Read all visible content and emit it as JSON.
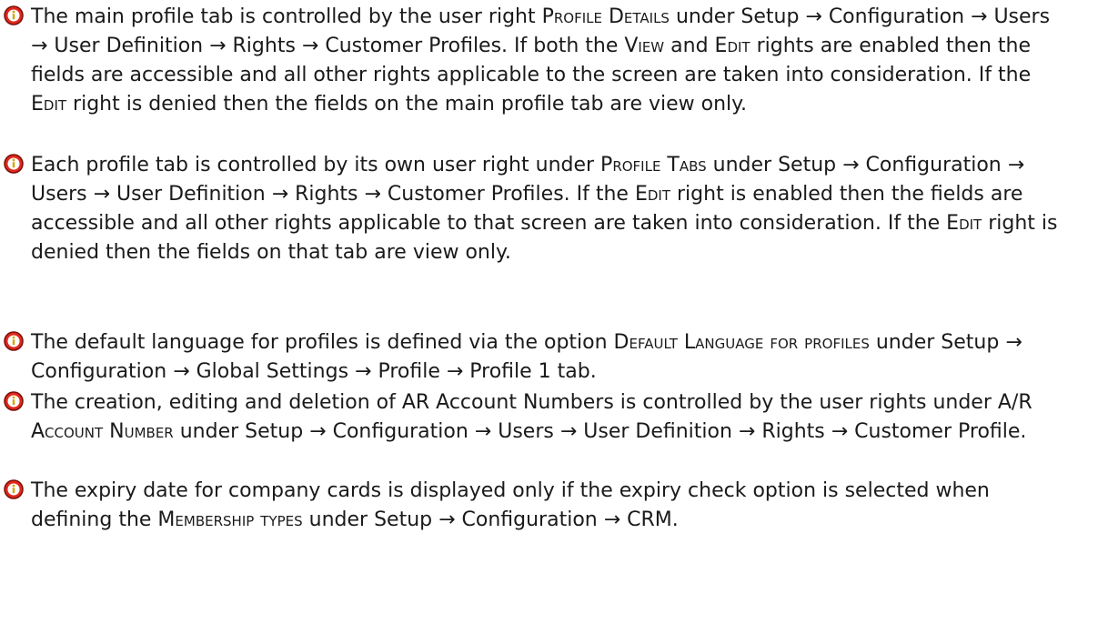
{
  "notes": [
    {
      "icon": "info-icon",
      "t1": "The main profile tab is controlled by the user right ",
      "s1": "Profile Details",
      "t2": " under Setup → Configuration → Users → User Definition → Rights → Customer Profiles. If both the ",
      "s2": "View",
      "t3": " and ",
      "s3": "Edit",
      "t4": " rights are enabled then the fields are accessible and all other rights applicable to the screen are taken into consideration. If the ",
      "s4": "Edit",
      "t5": " right is denied then the fields on the main profile tab are view only."
    },
    {
      "icon": "info-icon",
      "t1": "Each profile tab is controlled by its own user right under ",
      "s1": "Profile Tabs",
      "t2": " under Setup → Configuration → Users → User Definition → Rights → Customer Profiles. If the ",
      "s2": "Edit",
      "t3": " right is enabled then the fields are accessible and all other rights applicable to that screen are taken into consideration. If the ",
      "s3": "Edit",
      "t4": " right is denied then the fields on that tab are view only."
    },
    {
      "icon": "info-icon",
      "t1": "The default language for profiles is defined via the option ",
      "s1": "Default Language for profiles",
      "t2": " under Setup → Configuration → Global Settings → Profile → Profile 1 tab."
    },
    {
      "icon": "info-icon",
      "t1": "The creation, editing and deletion of AR Account Numbers is controlled by the user rights under ",
      "s1": "A/R Account Number",
      "t2": " under Setup → Configuration → Users → User Definition → Rights → Customer Profile."
    },
    {
      "icon": "info-icon",
      "t1": "The expiry date for company cards is displayed only if the expiry check option is selected when defining the ",
      "s1": "Membership types",
      "t2": " under Setup → Configuration → CRM."
    }
  ],
  "colors": {
    "icon_red": "#e0291b",
    "icon_dark": "#7a0f0a",
    "text": "#1a1a1a"
  }
}
